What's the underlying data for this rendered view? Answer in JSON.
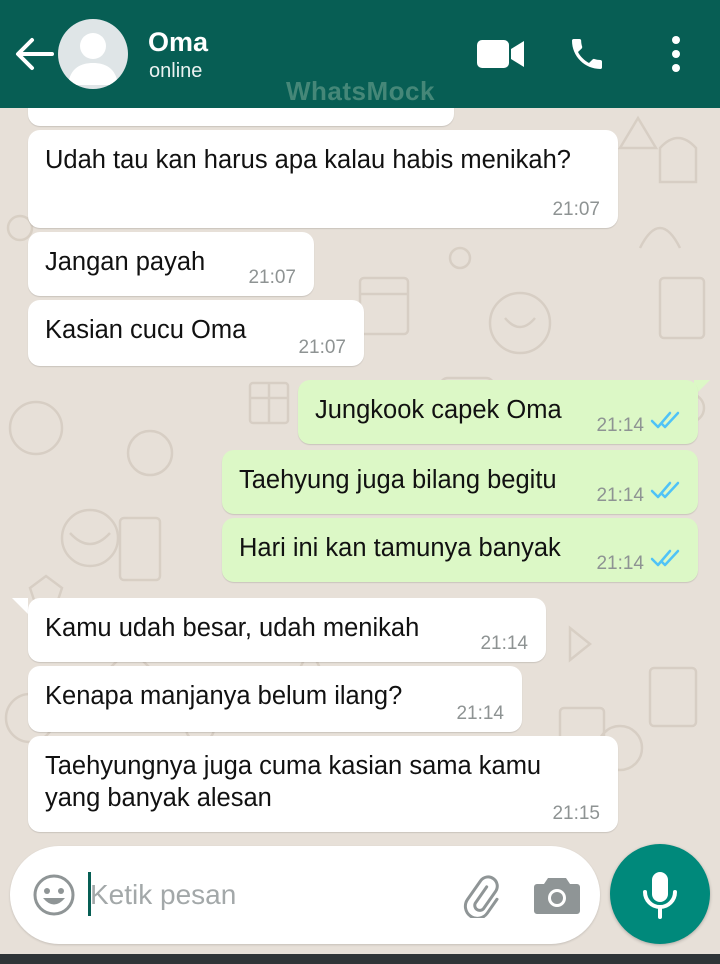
{
  "header": {
    "contact_name": "Oma",
    "status": "online",
    "watermark": "WhatsMock",
    "icons": [
      "back-arrow-icon",
      "avatar",
      "video-call-icon",
      "phone-call-icon",
      "more-options-icon"
    ]
  },
  "messages": [
    {
      "direction": "incoming",
      "text": "Udah tau kan harus apa kalau habis menikah?",
      "time": "21:07"
    },
    {
      "direction": "incoming",
      "text": "Jangan payah",
      "time": "21:07"
    },
    {
      "direction": "incoming",
      "text": "Kasian cucu Oma",
      "time": "21:07"
    },
    {
      "direction": "outgoing",
      "text": "Jungkook capek Oma",
      "time": "21:14",
      "status": "read"
    },
    {
      "direction": "outgoing",
      "text": "Taehyung juga bilang begitu",
      "time": "21:14",
      "status": "read"
    },
    {
      "direction": "outgoing",
      "text": "Hari ini kan tamunya banyak",
      "time": "21:14",
      "status": "read"
    },
    {
      "direction": "incoming",
      "text": "Kamu udah besar, udah menikah",
      "time": "21:14"
    },
    {
      "direction": "incoming",
      "text": "Kenapa manjanya belum ilang?",
      "time": "21:14"
    },
    {
      "direction": "incoming",
      "text": "Taehyungnya juga cuma kasian sama kamu yang banyak alesan",
      "time": "21:15"
    }
  ],
  "input": {
    "placeholder": "Ketik pesan",
    "value": ""
  },
  "colors": {
    "header": "#075e54",
    "incoming_bubble": "#ffffff",
    "outgoing_bubble": "#dcf8c6",
    "chat_background": "#e7e0d8",
    "read_ticks": "#4fc3f7",
    "mic_button": "#00897b"
  }
}
